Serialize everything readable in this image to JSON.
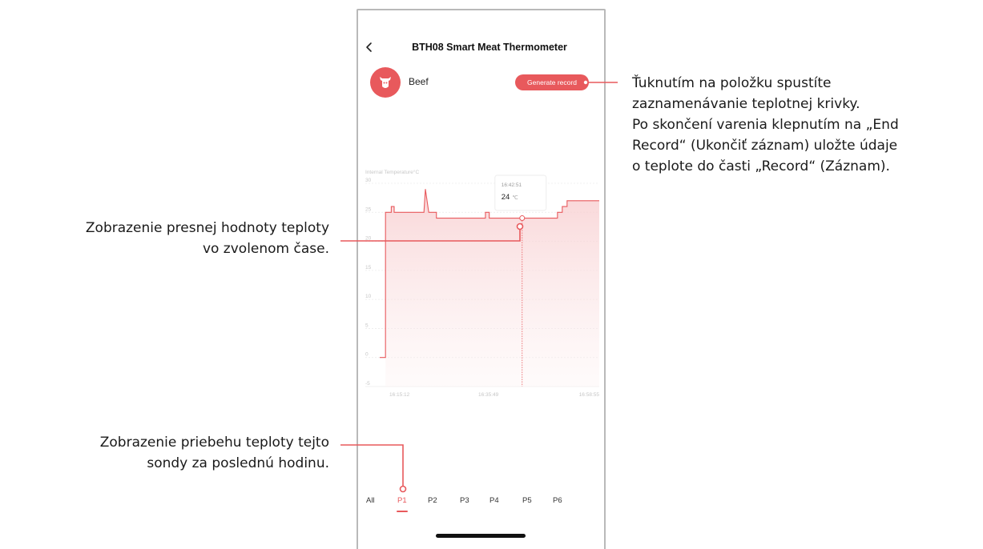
{
  "app": {
    "title": "BTH08 Smart Meat Thermometer",
    "food_label": "Beef",
    "generate_button": "Generate record",
    "back_icon": "chevron-left-icon",
    "food_icon": "cow-head-icon"
  },
  "colors": {
    "accent": "#e8595c",
    "fill": "#fbe3e4",
    "grid": "#e9e9e9"
  },
  "tooltip": {
    "time": "16:42:51",
    "value": "24",
    "unit": "℃"
  },
  "tabs": [
    {
      "label": "All",
      "active": false
    },
    {
      "label": "P1",
      "active": true
    },
    {
      "label": "P2",
      "active": false
    },
    {
      "label": "P3",
      "active": false
    },
    {
      "label": "P4",
      "active": false
    },
    {
      "label": "P5",
      "active": false
    },
    {
      "label": "P6",
      "active": false
    }
  ],
  "chart_data": {
    "type": "area",
    "ylabel": "Internal Temperature°C",
    "ylim": [
      -5,
      30
    ],
    "yticks": [
      "30",
      "25",
      "20",
      "15",
      "10",
      "5",
      "0",
      "-5"
    ],
    "xtick_labels": [
      "16:15:12",
      "16:35:49",
      "16:58:55"
    ],
    "grid": true,
    "series": [
      {
        "values_minutes_since_16_15_12": [
          -2,
          -0.8,
          -0.8,
          0.4,
          0.4,
          1.0,
          1.0,
          2.2,
          2.2,
          7.2,
          7.2,
          7.5,
          8.2,
          8.2,
          9.8,
          9.8,
          20.0,
          20.0,
          20.8,
          20.8,
          24.5,
          24.5,
          26.0,
          26.0,
          35.0,
          35.0,
          36.0,
          36.0,
          37.0,
          37.0,
          42.0,
          43.7
        ],
        "temps": [
          0,
          0,
          25,
          25,
          26,
          26,
          25,
          25,
          25,
          25,
          25,
          29,
          25,
          25,
          25,
          24,
          24,
          25,
          25,
          24,
          24,
          24,
          24,
          24,
          24,
          25,
          25,
          26,
          26,
          27,
          27,
          27
        ]
      }
    ]
  },
  "annotations": {
    "right": [
      "Ťuknutím na položku spustíte",
      "zaznamenávanie teplotnej krivky.",
      "Po skončení varenia klepnutím na „End",
      "Record“ (Ukončiť záznam) uložte údaje",
      "o teplote do časti „Record“ (Záznam)."
    ],
    "middle": [
      "Zobrazenie presnej hodnoty teploty",
      "vo zvolenom čase."
    ],
    "bottom": [
      "Zobrazenie priebehu teploty tejto",
      "sondy za poslednú hodinu."
    ]
  }
}
